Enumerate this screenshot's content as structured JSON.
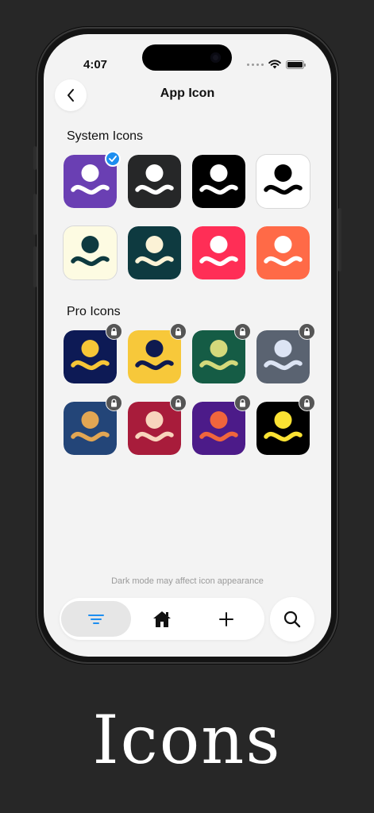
{
  "status_bar": {
    "time": "4:07"
  },
  "header": {
    "title": "App Icon"
  },
  "sections": {
    "system": {
      "label": "System Icons"
    },
    "pro": {
      "label": "Pro Icons"
    }
  },
  "system_icons": [
    {
      "bg": "#6a3fb3",
      "fg": "#ffffff",
      "wave": "#ffffff",
      "selected": true
    },
    {
      "bg": "#262728",
      "fg": "#ffffff",
      "wave": "#ffffff",
      "selected": false
    },
    {
      "bg": "#000000",
      "fg": "#ffffff",
      "wave": "#ffffff",
      "selected": false
    },
    {
      "bg": "#ffffff",
      "fg": "#000000",
      "wave": "#000000",
      "selected": false
    },
    {
      "bg": "#fdfbe2",
      "fg": "#0e3a40",
      "wave": "#0e3a40",
      "selected": false
    },
    {
      "bg": "#0e3a40",
      "fg": "#fbf2d6",
      "wave": "#fbf2d6",
      "selected": false
    },
    {
      "bg": "#ff2e56",
      "fg": "#ffffff",
      "wave": "#ffffff",
      "selected": false
    },
    {
      "bg": "#ff6a47",
      "fg": "#ffffff",
      "wave": "#ffffff",
      "selected": false
    }
  ],
  "pro_icons": [
    {
      "bg": "#0d1a55",
      "fg": "#f6c637",
      "wave": "#f6c637",
      "locked": true
    },
    {
      "bg": "#f7c83a",
      "fg": "#0f1a4f",
      "wave": "#0f1a4f",
      "locked": true
    },
    {
      "bg": "#155c45",
      "fg": "#d4d97b",
      "wave": "#d4d97b",
      "locked": true
    },
    {
      "bg": "#5a6371",
      "fg": "#dce4f4",
      "wave": "#dce4f4",
      "locked": true
    },
    {
      "bg": "#234578",
      "fg": "#e2a653",
      "wave": "#e2a653",
      "locked": true
    },
    {
      "bg": "#a81c3b",
      "fg": "#f8d5bd",
      "wave": "#f8d5bd",
      "locked": true
    },
    {
      "bg": "#4c1b89",
      "fg": "#f0653c",
      "wave": "#f0653c",
      "locked": true
    },
    {
      "bg": "#000000",
      "fg": "#fbe233",
      "wave": "#fbe233",
      "locked": true
    }
  ],
  "footer_note": "Dark mode may affect icon appearance",
  "tabbar": {
    "tabs": [
      {
        "icon": "list-filter-icon",
        "active": true,
        "color": "#1d8ef0"
      },
      {
        "icon": "home-icon",
        "active": false
      },
      {
        "icon": "plus-icon",
        "active": false
      }
    ],
    "search_icon": "search-icon"
  },
  "caption": "Icons"
}
